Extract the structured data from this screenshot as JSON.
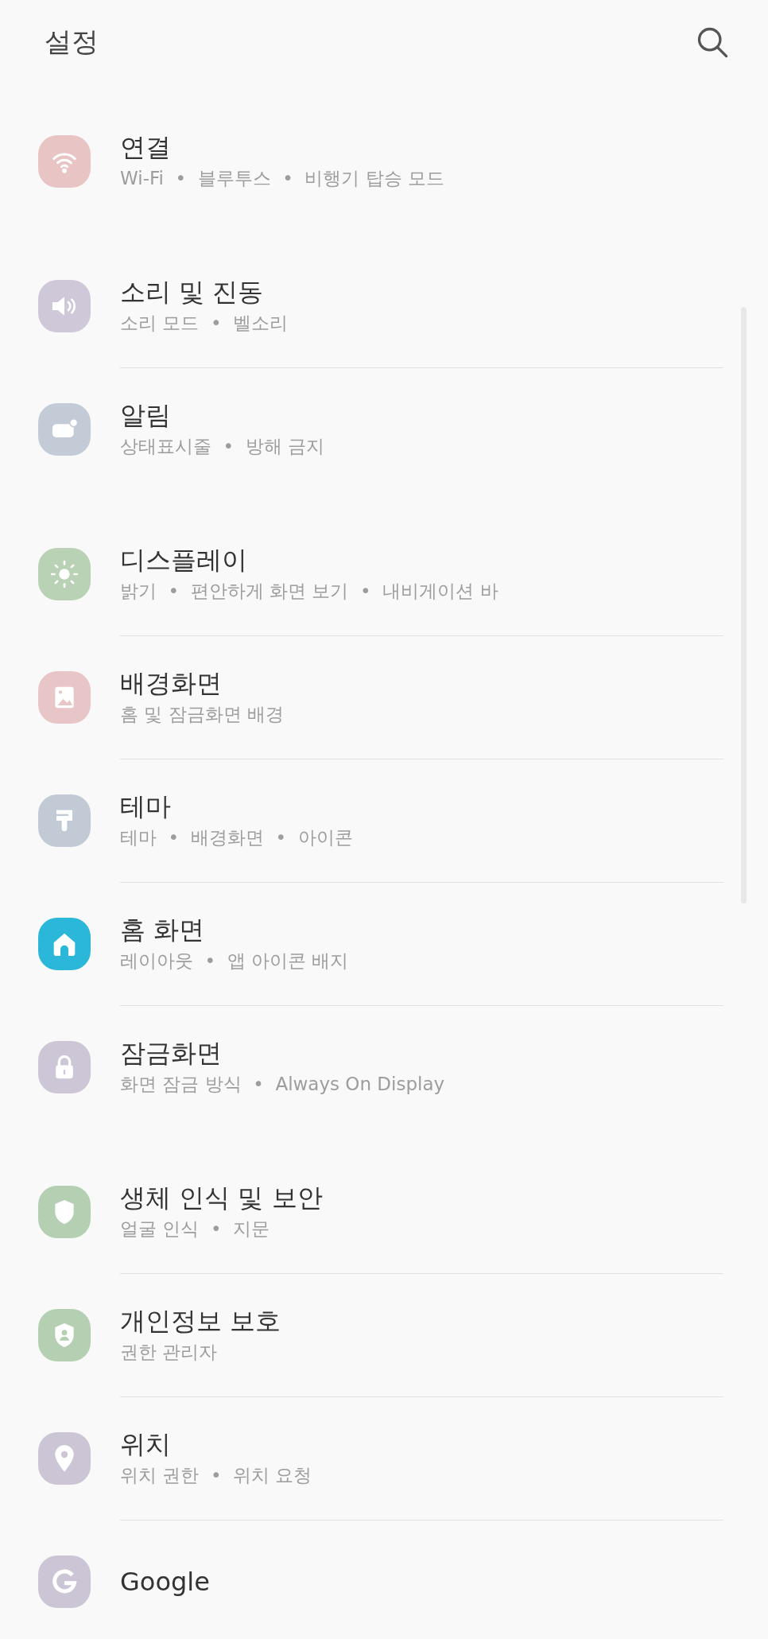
{
  "header": {
    "title": "설정"
  },
  "groups": [
    {
      "items": [
        {
          "kind": "wifi",
          "color": "#e8c4c4",
          "title": "연결",
          "subtitle": "Wi-Fi  •  블루투스  •  비행기 탑승 모드"
        }
      ]
    },
    {
      "items": [
        {
          "kind": "sound",
          "color": "#cfc8d8",
          "title": "소리 및 진동",
          "subtitle": "소리 모드  •  벨소리"
        },
        {
          "kind": "notification",
          "color": "#c3ccd6",
          "title": "알림",
          "subtitle": "상태표시줄  •  방해 금지"
        }
      ]
    },
    {
      "items": [
        {
          "kind": "display",
          "color": "#b9d1b4",
          "title": "디스플레이",
          "subtitle": "밝기  •  편안하게 화면 보기  •  내비게이션 바"
        },
        {
          "kind": "wallpaper",
          "color": "#e8c6c8",
          "title": "배경화면",
          "subtitle": "홈 및 잠금화면 배경"
        },
        {
          "kind": "theme",
          "color": "#c2cbd5",
          "title": "테마",
          "subtitle": "테마  •  배경화면  •  아이콘"
        },
        {
          "kind": "home",
          "color": "#2bb7d9",
          "title": "홈 화면",
          "subtitle": "레이아웃  •  앱 아이콘 배지"
        },
        {
          "kind": "lock",
          "color": "#cdc6d6",
          "title": "잠금화면",
          "subtitle": "화면 잠금 방식  •  Always On Display"
        }
      ]
    },
    {
      "items": [
        {
          "kind": "shield",
          "color": "#b5cfb2",
          "title": "생체 인식 및 보안",
          "subtitle": "얼굴 인식  •  지문"
        },
        {
          "kind": "privacy",
          "color": "#b5cfb2",
          "title": "개인정보 보호",
          "subtitle": "권한 관리자"
        },
        {
          "kind": "location",
          "color": "#cbc5d6",
          "title": "위치",
          "subtitle": "위치 권한  •  위치 요청"
        },
        {
          "kind": "google",
          "color": "#cbc5d6",
          "title": "Google"
        }
      ]
    }
  ]
}
